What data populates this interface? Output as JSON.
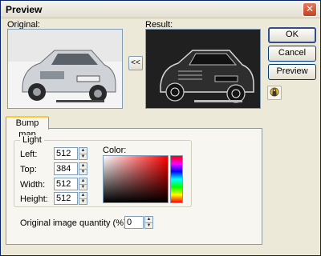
{
  "window": {
    "title": "Preview"
  },
  "labels": {
    "original": "Original:",
    "result": "Result:"
  },
  "buttons": {
    "ok": "OK",
    "cancel": "Cancel",
    "preview": "Preview",
    "swap": "<<"
  },
  "tabs": [
    {
      "label": "Bump map"
    }
  ],
  "light_group": {
    "title": "Light",
    "fields": [
      {
        "label": "Left:",
        "value": "512"
      },
      {
        "label": "Top:",
        "value": "384"
      },
      {
        "label": "Width:",
        "value": "512"
      },
      {
        "label": "Height:",
        "value": "512"
      }
    ],
    "color_label": "Color:"
  },
  "quantity": {
    "label": "Original image quantity (%):",
    "value": "0"
  },
  "colors": {
    "titlebar_border": "#0a246a",
    "dialog_bg": "#ece9d8",
    "close": "#c2411f",
    "tab_highlight": "#ffc83c"
  },
  "icons": {
    "close": "close-icon",
    "swap": "arrow-left-icon",
    "lock": "lock-icon",
    "spin_up": "chevron-up-icon",
    "spin_down": "chevron-down-icon"
  }
}
